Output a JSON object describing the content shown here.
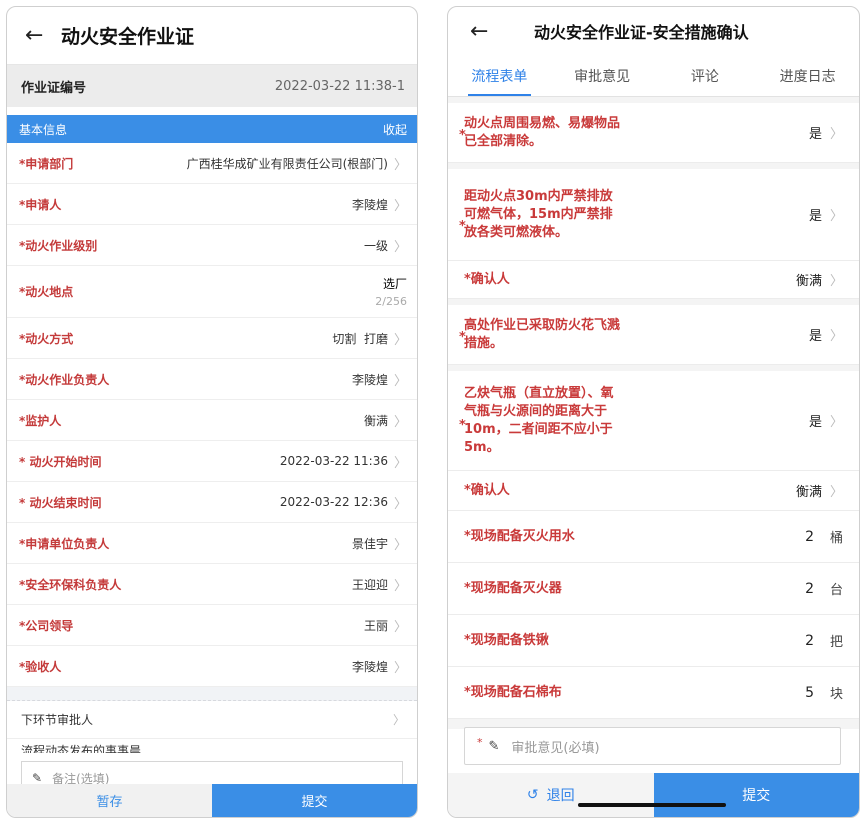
{
  "left": {
    "title": "动火安全作业证",
    "permit_no": {
      "label": "作业证编号",
      "value": "2022-03-22 11:38-1"
    },
    "section": {
      "title": "基本信息",
      "toggle": "收起"
    },
    "rows": [
      {
        "label": "*申请部门",
        "value": "广西桂华成矿业有限责任公司(根部门)"
      },
      {
        "label": "*申请人",
        "value": "李陵煌"
      },
      {
        "label": "*动火作业级别",
        "value": "一级"
      },
      {
        "label": "*动火地点",
        "value": "选厂",
        "sub": "2/256"
      },
      {
        "label": "*动火方式",
        "value": "切割  打磨"
      },
      {
        "label": "*动火作业负责人",
        "value": "李陵煌"
      },
      {
        "label": "*监护人",
        "value": "衡满"
      },
      {
        "label": "* 动火开始时间",
        "value": "2022-03-22 11:36"
      },
      {
        "label": "* 动火结束时间",
        "value": "2022-03-22 12:36"
      },
      {
        "label": "*申请单位负责人",
        "value": "景佳宇"
      },
      {
        "label": "*安全环保科负责人",
        "value": "王迎迎"
      },
      {
        "label": "*公司领导",
        "value": "王丽"
      },
      {
        "label": "*验收人",
        "value": "李陵煌"
      }
    ],
    "next_approver": "下环节审批人",
    "cut_text": "流程动态发布的事事晨",
    "remark_placeholder": "备注(选填)",
    "save_label": "暂存",
    "submit_label": "提交"
  },
  "right": {
    "title": "动火安全作业证-安全措施确认",
    "tabs": [
      "流程表单",
      "审批意见",
      "评论",
      "进度日志"
    ],
    "items": [
      {
        "label": "动火点周围易燃、易爆物品已全部清除。",
        "value": "是"
      },
      {
        "label": "距动火点30m内严禁排放可燃气体，15m内严禁排放各类可燃液体。",
        "value": "是"
      },
      {
        "label": "*确认人",
        "value": "衡满"
      },
      {
        "label": "高处作业已采取防火花飞溅措施。",
        "value": "是"
      },
      {
        "label": "乙炔气瓶（直立放置）、氧气瓶与火源间的距离大于10m，二者间距不应小于5m。",
        "value": "是"
      },
      {
        "label": "*确认人",
        "value": "衡满"
      },
      {
        "label": "*现场配备灭火用水",
        "qty": "2",
        "unit": "桶"
      },
      {
        "label": "*现场配备灭火器",
        "qty": "2",
        "unit": "台"
      },
      {
        "label": "*现场配备铁锹",
        "qty": "2",
        "unit": "把"
      },
      {
        "label": "*现场配备石棉布",
        "qty": "5",
        "unit": "块"
      }
    ],
    "comment_star": "*",
    "comment_placeholder": "审批意见(必填)",
    "retreat_label": "退回",
    "submit_label": "提交"
  }
}
